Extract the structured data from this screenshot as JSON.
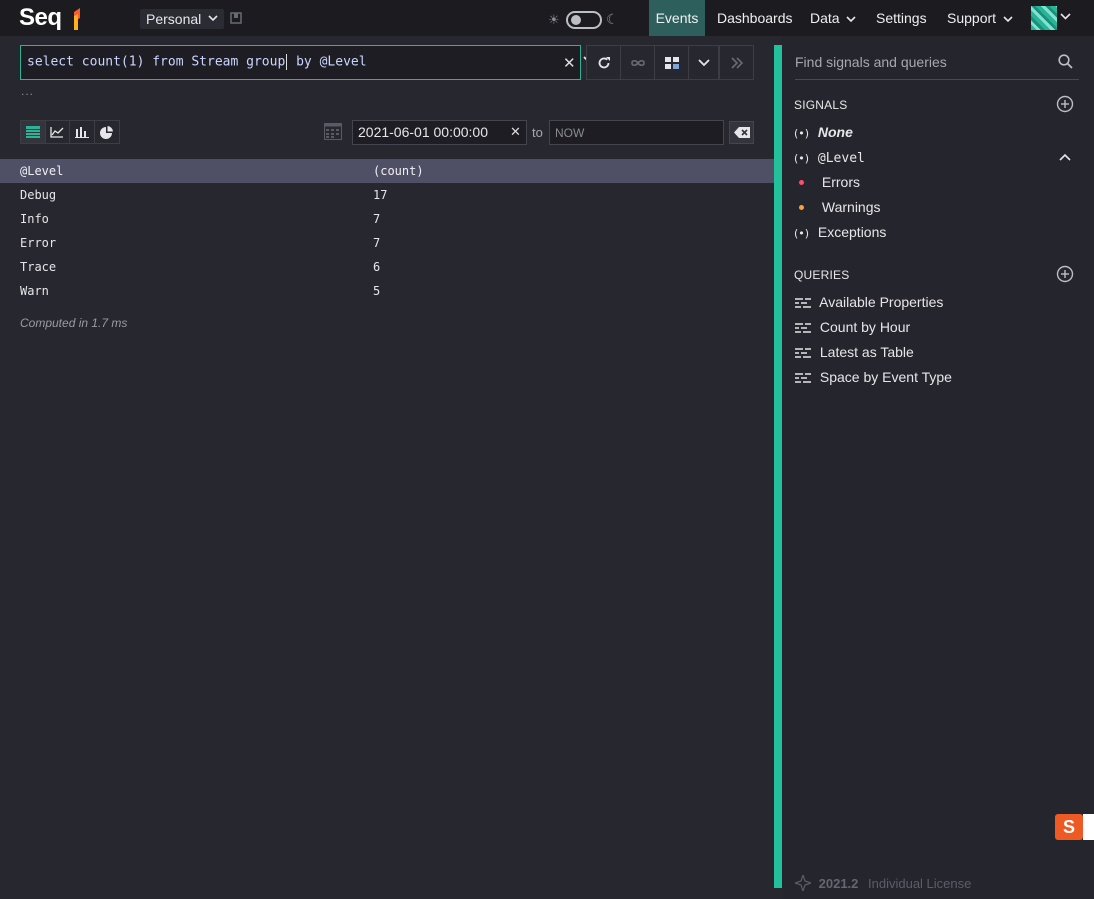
{
  "app": {
    "name": "Seq",
    "accent": "#2bb39a",
    "divider_color": "#22c19b"
  },
  "header": {
    "workspace": "Personal",
    "nav": {
      "events": "Events",
      "dashboards": "Dashboards",
      "data": "Data",
      "settings": "Settings",
      "support": "Support"
    }
  },
  "query": {
    "text_before_cursor": "select count(1) from Stream group",
    "text_after_cursor": " by @Level",
    "more_indicator": "..."
  },
  "range": {
    "from": "2021-06-01 00:00:00",
    "to_label": "to",
    "to_placeholder": "NOW"
  },
  "results": {
    "columns": [
      "@Level",
      "(count)"
    ],
    "rows": [
      [
        "Debug",
        "17"
      ],
      [
        "Info",
        "7"
      ],
      [
        "Error",
        "7"
      ],
      [
        "Trace",
        "6"
      ],
      [
        "Warn",
        "5"
      ]
    ],
    "computed": "Computed in 1.7 ms"
  },
  "side": {
    "search_placeholder": "Find signals and queries",
    "signals_title": "SIGNALS",
    "signals": {
      "none": "None",
      "level": "@Level",
      "errors": "Errors",
      "warnings": "Warnings",
      "exceptions": "Exceptions"
    },
    "colors": {
      "errors": "#ff4d6d",
      "warnings": "#ffa033"
    },
    "queries_title": "QUERIES",
    "queries": [
      "Available Properties",
      "Count by Hour",
      "Latest as Table",
      "Space by Event Type"
    ],
    "footer_version": "2021.2",
    "footer_license": "Individual License"
  },
  "ime": {
    "label": "S"
  }
}
